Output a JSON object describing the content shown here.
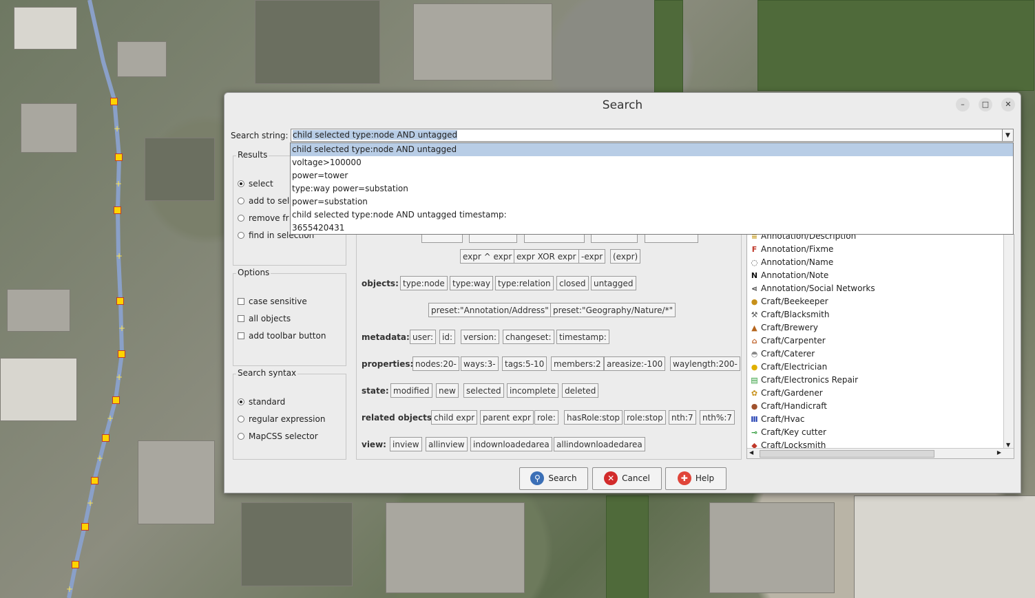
{
  "dialog": {
    "title": "Search",
    "minimize_glyph": "–",
    "maximize_glyph": "□",
    "close_glyph": "✕"
  },
  "search": {
    "label": "Search string:",
    "value": "child selected type:node AND untagged",
    "dropdown_arrow": "▼"
  },
  "history": [
    "child selected type:node AND untagged",
    "voltage>100000",
    "power=tower",
    "type:way power=substation",
    "power=substation",
    "child selected type:node AND untagged timestamp:",
    "3655420431"
  ],
  "results": {
    "title": "Results",
    "options": [
      "select",
      "add to sele",
      "remove fr",
      "find in selection"
    ],
    "selected_index": 0
  },
  "options_group": {
    "title": "Options",
    "items": [
      "case sensitive",
      "all objects",
      "add toolbar button"
    ]
  },
  "syntax": {
    "title": "Search syntax",
    "options": [
      "standard",
      "regular expression",
      "MapCSS selector"
    ],
    "selected_index": 0
  },
  "hints": {
    "operators_row": [
      "expr ^ expr",
      "expr XOR expr",
      "-expr",
      "(expr)"
    ],
    "objects": {
      "label": "objects:",
      "chips": [
        "type:node",
        "type:way",
        "type:relation",
        "closed",
        "untagged"
      ]
    },
    "presets_row": [
      "preset:\"Annotation/Address\"",
      "preset:\"Geography/Nature/*\""
    ],
    "metadata": {
      "label": "metadata:",
      "chips": [
        "user:",
        "id:",
        "version:",
        "changeset:",
        "timestamp:"
      ]
    },
    "properties": {
      "label": "properties:",
      "chips": [
        "nodes:20-",
        "ways:3-",
        "tags:5-10",
        "members:2",
        "areasize:-100",
        "waylength:200-"
      ]
    },
    "state": {
      "label": "state:",
      "chips": [
        "modified",
        "new",
        "selected",
        "incomplete",
        "deleted"
      ]
    },
    "related": {
      "label": "related objects:",
      "chips": [
        "child expr",
        "parent expr",
        "role:",
        "hasRole:stop",
        "role:stop",
        "nth:7",
        "nth%:7"
      ]
    },
    "view": {
      "label": "view:",
      "chips": [
        "inview",
        "allinview",
        "indownloadedarea",
        "allindownloadedarea"
      ]
    }
  },
  "presets": [
    {
      "label": "Annotation/Description",
      "icon": "lines-icon"
    },
    {
      "label": "Annotation/Fixme",
      "icon": "letter-f-icon"
    },
    {
      "label": "Annotation/Name",
      "icon": "speech-bubble-icon"
    },
    {
      "label": "Annotation/Note",
      "icon": "letter-n-icon"
    },
    {
      "label": "Annotation/Social Networks",
      "icon": "share-icon"
    },
    {
      "label": "Craft/Beekeeper",
      "icon": "beehive-icon"
    },
    {
      "label": "Craft/Blacksmith",
      "icon": "anvil-icon"
    },
    {
      "label": "Craft/Brewery",
      "icon": "brewery-icon"
    },
    {
      "label": "Craft/Carpenter",
      "icon": "house-icon"
    },
    {
      "label": "Craft/Caterer",
      "icon": "cloche-icon"
    },
    {
      "label": "Craft/Electrician",
      "icon": "plug-icon"
    },
    {
      "label": "Craft/Electronics Repair",
      "icon": "circuit-board-icon"
    },
    {
      "label": "Craft/Gardener",
      "icon": "watering-can-icon"
    },
    {
      "label": "Craft/Handicraft",
      "icon": "vase-icon"
    },
    {
      "label": "Craft/Hvac",
      "icon": "radiator-icon"
    },
    {
      "label": "Craft/Key cutter",
      "icon": "key-icon"
    },
    {
      "label": "Craft/Locksmith",
      "icon": "lock-icon"
    }
  ],
  "buttons": {
    "search": "Search",
    "cancel": "Cancel",
    "help": "Help"
  },
  "colors": {
    "selection": "#b8cde6",
    "node_fill": "#ffd400",
    "road": "#8aa0c8"
  }
}
